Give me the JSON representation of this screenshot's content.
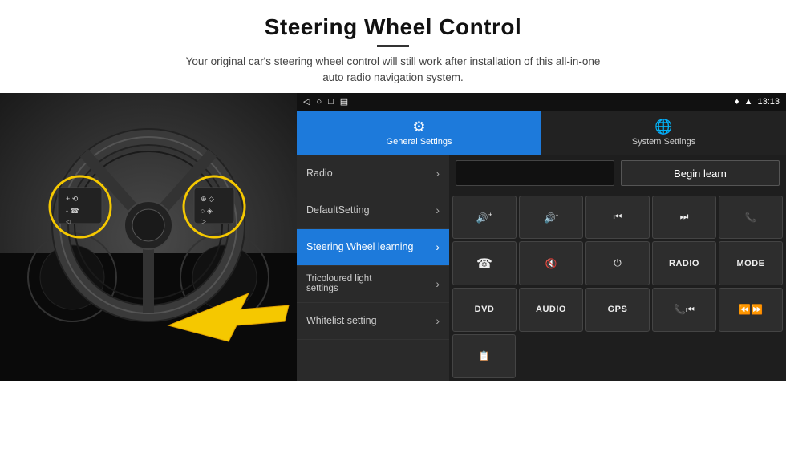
{
  "header": {
    "title": "Steering Wheel Control",
    "subtitle": "Your original car's steering wheel control will still work after installation of this all-in-one\nauto radio navigation system."
  },
  "status_bar": {
    "icons": [
      "◁",
      "○",
      "□",
      "▤"
    ],
    "right_icons": "♥ ▲",
    "time": "13:13"
  },
  "tabs": [
    {
      "id": "general",
      "label": "General Settings",
      "active": true
    },
    {
      "id": "system",
      "label": "System Settings",
      "active": false
    }
  ],
  "menu_items": [
    {
      "id": "radio",
      "label": "Radio",
      "active": false
    },
    {
      "id": "default",
      "label": "DefaultSetting",
      "active": false
    },
    {
      "id": "steering",
      "label": "Steering Wheel learning",
      "active": true
    },
    {
      "id": "tricolour",
      "label": "Tricoloured light settings",
      "active": false
    },
    {
      "id": "whitelist",
      "label": "Whitelist setting",
      "active": false
    }
  ],
  "begin_learn_label": "Begin learn",
  "control_buttons": {
    "row1": [
      "🔊+",
      "🔊-",
      "⏮",
      "⏭",
      "📞"
    ],
    "row2": [
      "📞",
      "🔇",
      "⏻",
      "RADIO",
      "MODE"
    ],
    "row3": [
      "DVD",
      "AUDIO",
      "GPS",
      "📞⏮",
      "⏪⏩"
    ],
    "row4": [
      "📋"
    ]
  }
}
